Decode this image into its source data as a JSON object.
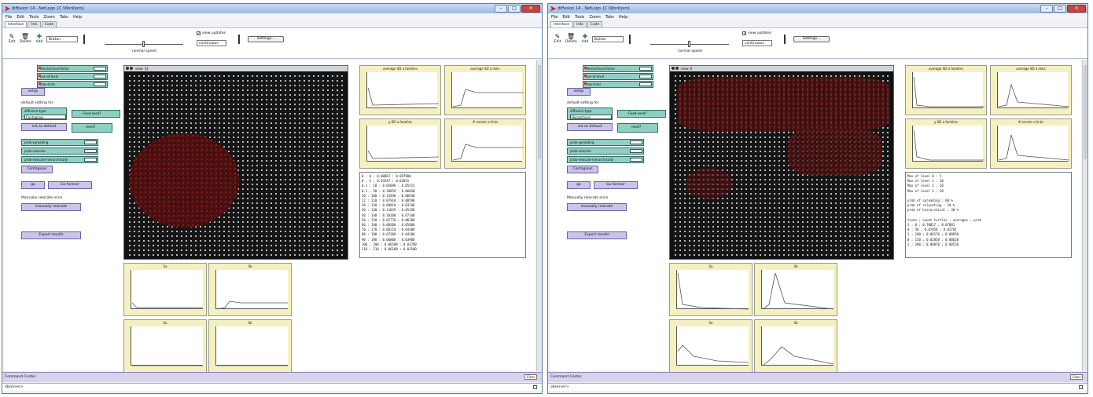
{
  "windows": [
    {
      "title": "diffusion 14 - NetLogo {C:\\Work\\pro}",
      "menu": [
        "File",
        "Edit",
        "Tools",
        "Zoom",
        "Tabs",
        "Help"
      ],
      "tabs": [
        "Interface",
        "Info",
        "Code"
      ],
      "toolbar": {
        "edit": "Edit",
        "delete": "Delete",
        "add": "Add",
        "add_type": "Button",
        "speed_label": "normal speed",
        "view_updates": "view updates",
        "update_mode": "continuous",
        "settings": "Settings..."
      },
      "left_panel": {
        "sliders": [
          "Hierarchical-factor",
          "use-of-level",
          "max-links"
        ],
        "setup": "setup",
        "default_heading": "default setting for",
        "diffusion_chooser": "diffusion-type",
        "diffusion_value": "Contagious",
        "fixed_seed": "Fixed-seed?",
        "set_default": "set as default",
        "reset_btn": "reset?",
        "probs": [
          "prob-spreading",
          "prob-relocate",
          "prob-relocate-hierarchically"
        ],
        "contagious": "Contagious",
        "go": "go",
        "go_forever": "Go forever",
        "manual_heading": "Manually relocate once",
        "manual_btn": "manually relocate",
        "export_btn": "Export results"
      },
      "world_label": "view: 14",
      "top_plots": [
        "average SD a families",
        "average SD a links",
        "y-SD a families",
        "# events a links"
      ],
      "output_text": "0 : 0 : 0.00867 : 0.067900\n0 : 5 : 0.03547 : 0.03815\n0.1 : 10 : 0.05098 : 0.05515\n0.2 : 50 : 0.10858 : 0.06030\n10 : 100 : 0.15040 : 0.06930\n12 : 110 : 0.07910 : 0.00590\n20 : 120 : 0.09810 : 0.03240\n30 : 130 : 0.11839 : 0.05190\n40 : 140 : 0.10200 : 0.07340\n50 : 150 : 0.07770 : 0.06200\n60 : 160 : 0.08300 : 0.05600\n70 : 170 : 0.06210 : 0.04300\n80 : 180 : 0.07300 : 0.04100\n90 : 190 : 0.06800 : 0.03900\n100 : 200 : 0.06500 : 0.03700\n110 : 210 : 0.06100 : 0.03500",
      "bottom_plots": [
        "Sa",
        "Sb",
        "Sa",
        "Sb"
      ],
      "command_center": "Command Center",
      "clear": "Clear",
      "observer": "observer>"
    },
    {
      "title": "diffusion 14 - NetLogo {C:\\Work\\pro}",
      "menu": [
        "File",
        "Edit",
        "Tools",
        "Zoom",
        "Tabs",
        "Help"
      ],
      "tabs": [
        "Interface",
        "Info",
        "Code"
      ],
      "toolbar": {
        "edit": "Edit",
        "delete": "Delete",
        "add": "Add",
        "add_type": "Button",
        "speed_label": "normal speed",
        "view_updates": "view updates",
        "update_mode": "continuous",
        "settings": "Settings..."
      },
      "left_panel": {
        "sliders": [
          "Hierarchical-factor",
          "use-of-level",
          "max-links"
        ],
        "setup": "setup",
        "default_heading": "default setting for",
        "diffusion_chooser": "diffusion-type",
        "diffusion_value": "Hierarchical",
        "fixed_seed": "Fixed-seed?",
        "set_default": "set as default",
        "reset_btn": "reset?",
        "probs": [
          "prob-spreading",
          "prob-relocate",
          "prob-relocate-hierarchically"
        ],
        "contagious": "Contagious",
        "go": "go",
        "go_forever": "Go forever",
        "manual_heading": "Manually relocate once",
        "manual_btn": "manually relocate",
        "export_btn": "Export results"
      },
      "world_label": "view: 9",
      "top_plots": [
        "average SD a families",
        "average SD a links",
        "y-SD a families",
        "# events a links"
      ],
      "output_text": "Max of level 0 : 5\nMax of level 1 : 10\nMax of level 2 : 20\nMax of level 3 : 50\n\nprob of spreading : 60 %\nprob of relocating : 10 %\nprob of hierarchical : 30 %\n\nticks ; count turtles ; averages ; prob\n1 ; 0 ; 0.70857 ; 0.07801\n0 ; 50 ; 0.07850 ; 0.02781\n1 ; 100 ; 0.08170 ; 0.00950\n0 ; 150 ; 0.02850 ; 0.00620\n1 ; 200 ; 0.00870 ; 0.00520",
      "bottom_plots": [
        "Sa",
        "Sb",
        "Sa",
        "Sb"
      ],
      "command_center": "Command Center",
      "clear": "Clear",
      "observer": "observer>"
    }
  ]
}
